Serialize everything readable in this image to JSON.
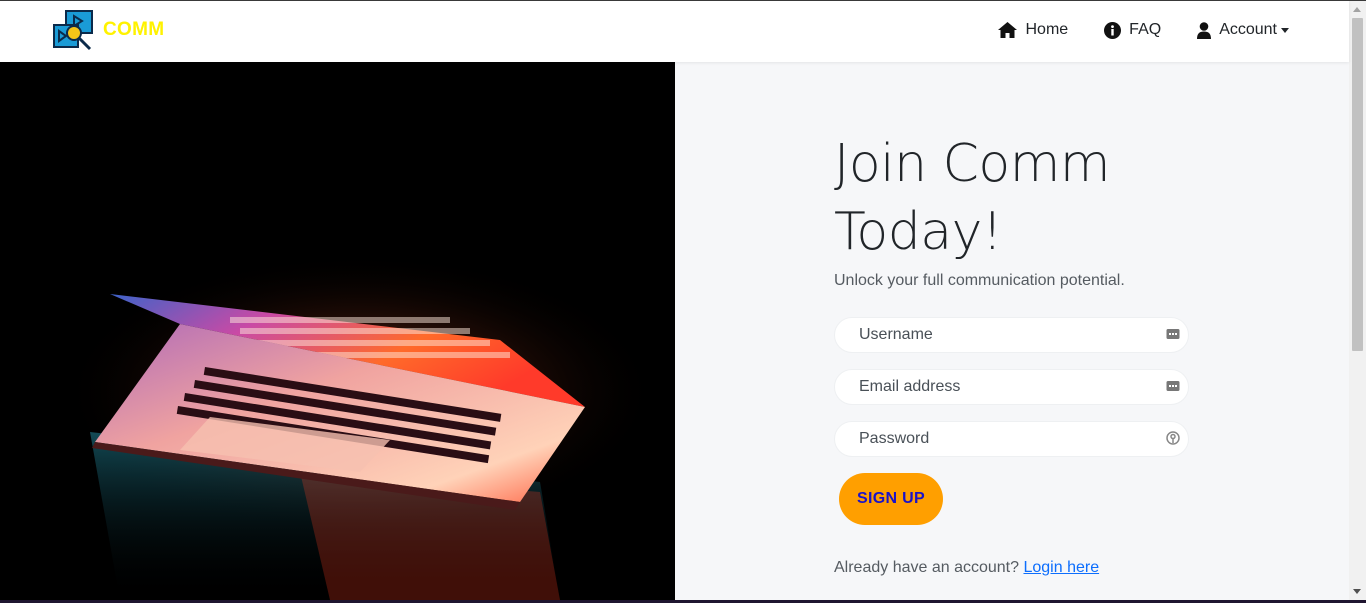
{
  "brand": {
    "name": "COMM",
    "logo_icon": "search-video-icon",
    "color": "#fff200"
  },
  "nav": {
    "items": [
      {
        "label": "Home",
        "icon": "home-icon"
      },
      {
        "label": "FAQ",
        "icon": "info-circle-icon"
      },
      {
        "label": "Account",
        "icon": "person-icon",
        "dropdown": true
      }
    ]
  },
  "hero": {
    "image": "laptop-glowing-keyboard-photo"
  },
  "signup_form": {
    "headline": "Join Comm Today!",
    "subtitle": "Unlock your full communication potential.",
    "username_placeholder": "Username",
    "email_placeholder": "Email address",
    "password_placeholder": "Password",
    "submit_label": "SIGN UP",
    "login_prompt": "Already have an account?",
    "login_link": "Login here"
  },
  "colors": {
    "accent": "#ff9f00",
    "button_text": "#1a12c9",
    "link": "#0d6efd",
    "panel_bg": "#f6f7f9"
  }
}
